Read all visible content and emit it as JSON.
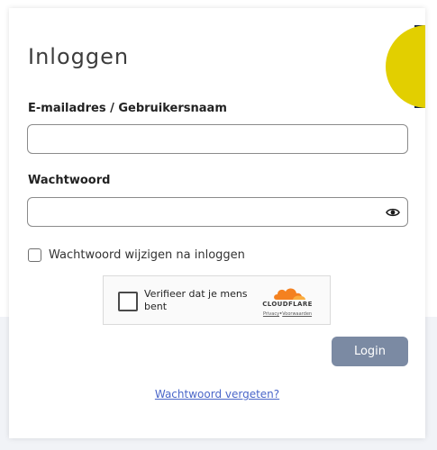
{
  "form": {
    "title": "Inloggen",
    "email_label": "E-mailadres / Gebruikersnaam",
    "email_value": "",
    "password_label": "Wachtwoord",
    "password_value": "",
    "change_password_label": "Wachtwoord wijzigen na inloggen",
    "login_label": "Login",
    "forgot_label": "Wachtwoord vergeten?"
  },
  "captcha": {
    "text": "Verifieer dat je mens bent",
    "brand": "CLOUDFLARE",
    "privacy_label": "Privacy",
    "separator": "•",
    "terms_label": "Voorwaarden"
  },
  "icons": {
    "password_toggle": "eye-icon",
    "captcha_logo": "cloudflare-cloud-icon"
  },
  "colors": {
    "accent_yellow": "#e2cf00",
    "accent_navy": "#0f1f45",
    "login_button": "#7b8aa3",
    "link": "#4a66c9"
  }
}
